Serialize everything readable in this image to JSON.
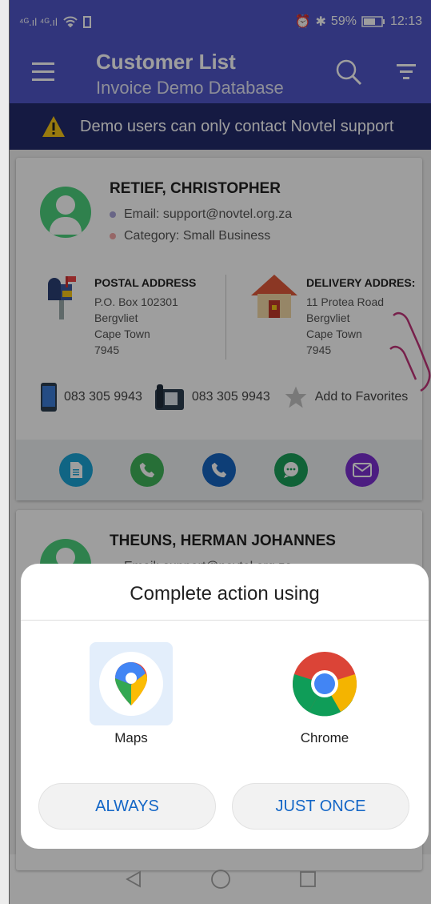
{
  "status_bar": {
    "signal_left": "⁴ᴳ.ıl ⁴ᴳ.ıl",
    "battery": "59%",
    "time": "12:13"
  },
  "toolbar": {
    "title": "Customer List",
    "subtitle": "Invoice Demo Database"
  },
  "banner": {
    "text": "Demo users can only contact Novtel support"
  },
  "customers": [
    {
      "name": "RETIEF, CHRISTOPHER",
      "email": "Email: support@novtel.org.za",
      "category": "Category: Small Business",
      "postal_header": "POSTAL ADDRESS",
      "postal_lines": [
        "P.O. Box 102301",
        "Bergvliet",
        "Cape Town",
        "7945"
      ],
      "delivery_header": "DELIVERY ADDRES:",
      "delivery_lines": [
        "11 Protea Road",
        "Bergvliet",
        "Cape Town",
        "7945"
      ],
      "mobile": "083 305 9943",
      "landline": "083 305 9943",
      "favorite": "Add to Favorites"
    },
    {
      "name": "THEUNS, HERMAN JOHANNES",
      "email": "Email: support@novtel.org.za"
    }
  ],
  "dialog": {
    "title": "Complete action using",
    "apps": [
      {
        "label": "Maps",
        "icon": "google-maps-icon"
      },
      {
        "label": "Chrome",
        "icon": "chrome-icon"
      }
    ],
    "always_label": "ALWAYS",
    "once_label": "JUST ONCE"
  },
  "colors": {
    "primary": "#4f56c8",
    "banner": "#232a6b",
    "accent_blue": "#1366c6",
    "avatar_green": "#4cd07d"
  }
}
